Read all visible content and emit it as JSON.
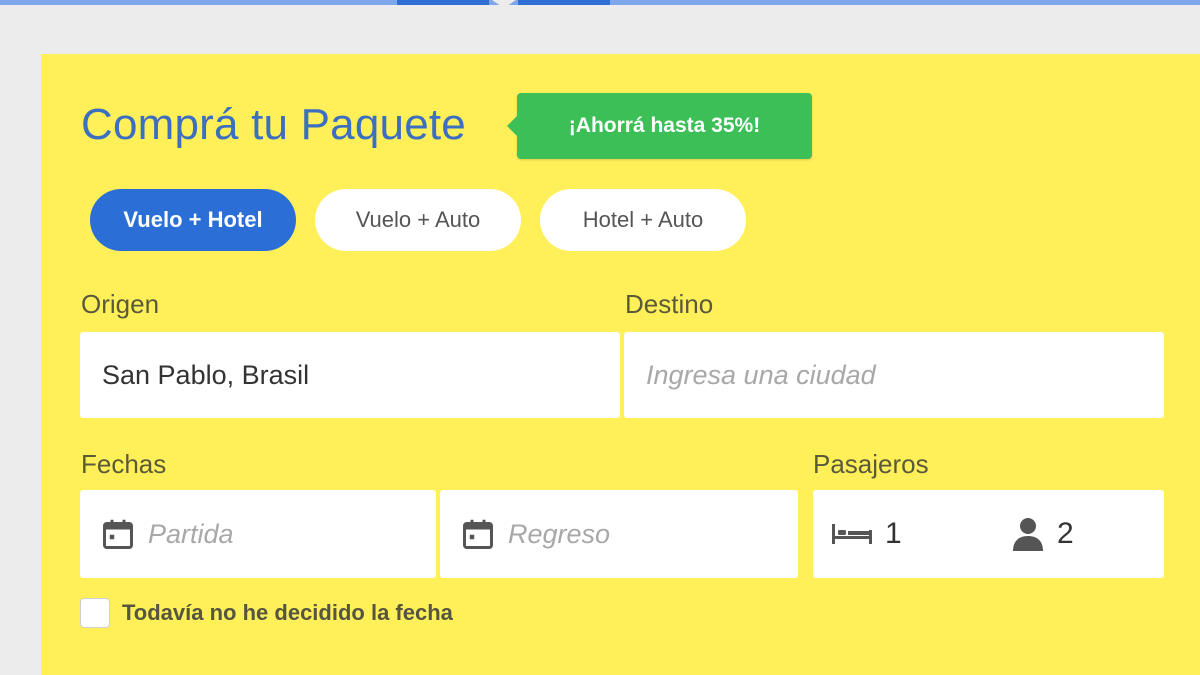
{
  "header": {
    "title": "Comprá tu Paquete",
    "promo_badge": "¡Ahorrá hasta 35%!"
  },
  "tabs": [
    {
      "label": "Vuelo + Hotel",
      "active": true
    },
    {
      "label": "Vuelo + Auto",
      "active": false
    },
    {
      "label": "Hotel + Auto",
      "active": false
    }
  ],
  "form": {
    "origin": {
      "label": "Origen",
      "value": "San Pablo, Brasil"
    },
    "destination": {
      "label": "Destino",
      "placeholder": "Ingresa una ciudad"
    },
    "dates": {
      "label": "Fechas",
      "departure_placeholder": "Partida",
      "return_placeholder": "Regreso",
      "icon": "calendar-icon"
    },
    "passengers": {
      "label": "Pasajeros",
      "rooms": "1",
      "rooms_icon": "bed-icon",
      "people": "2",
      "people_icon": "person-icon"
    },
    "undecided_dates": {
      "label": "Todavía no he decidido la fecha",
      "checked": false
    }
  },
  "colors": {
    "panel_bg": "#fff05a",
    "title": "#3c6fbf",
    "promo": "#3cbf57",
    "active_tab": "#2b6fd6",
    "page_bg": "#ececec"
  }
}
